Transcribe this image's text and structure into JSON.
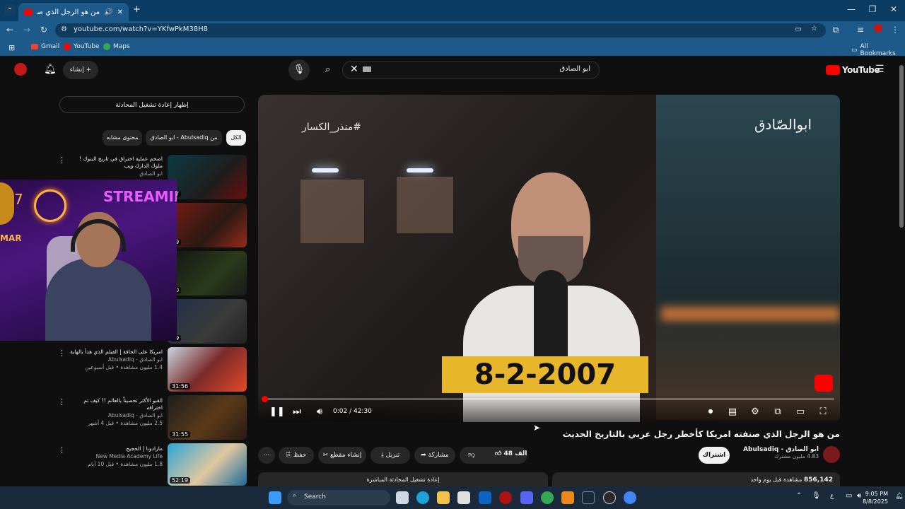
{
  "browser": {
    "tab_title": "من هو الرجل الذي صنفته امر",
    "url": "youtube.com/watch?v=YKfwPkM38H8",
    "bookmarks": [
      "Gmail",
      "YouTube",
      "Maps"
    ],
    "all_bookmarks": "All Bookmarks"
  },
  "youtube": {
    "logo": "YouTube",
    "search_query": "ابو الصادق",
    "create_label": "إنشاء",
    "show_chat_replay": "إظهار إعادة تشغيل المحادثة",
    "chips": [
      "الكل",
      "من Abulsadiq - ابو الصادق",
      "محتوى مشابه"
    ]
  },
  "video": {
    "hashtag": "#منذر_الكسار",
    "watermark": "ابوالصّادق",
    "date_banner": "8-2-2007",
    "time": "0:02 / 42:30",
    "progress": 0.001,
    "title": "من هو الرجل الذي صنفته امريكا كأخطر رجل عربي بالتاريخ الحديث",
    "channel": "Abulsadiq - ابو الصادق",
    "subscribers": "4.83 مليون مشترك",
    "subscribe": "اشتراك",
    "likes": "48 الف",
    "share": "مشاركة",
    "download": "تنزيل",
    "clip": "إنشاء مقطع",
    "save": "حفظ",
    "views": "856,142",
    "views_meta": "مشاهدة قبل يوم واحد",
    "chat_replay_bottom": "إعادة تشغيل المحادثة المباشرة"
  },
  "related": [
    {
      "title": "اضخم عملية اختراق في تاريخ البنوك ! ملوك الدارك ويب",
      "channel": "ابو الصادق",
      "meta": "",
      "duration": "27"
    },
    {
      "title": "",
      "channel": "",
      "meta": "",
      "duration": "49"
    },
    {
      "title": "",
      "channel": "",
      "meta": "",
      "duration": "30"
    },
    {
      "title": "",
      "channel": "",
      "meta": "",
      "duration": "29"
    },
    {
      "title": "امريكا على الحافة | الفيلم الذي هدأ بالهاية",
      "channel": "ابو الصادق - Abulsadiq",
      "meta": "1.4 مليون مشاهدة • قبل أسبوعين",
      "duration": "31:56"
    },
    {
      "title": "القبو الأكثر تحصيناً بالعالم !! كيف تم اختراقه",
      "channel": "ابو الصادق - Abulsadiq",
      "meta": "2.5 مليون مشاهدة • قبل 4 أشهر",
      "duration": "31:55"
    },
    {
      "title": "مارادونا | الحجيح",
      "channel": "New Media Academy Life",
      "meta": "1.8 مليون مشاهدة • قبل 10 أيام",
      "duration": "52:19"
    }
  ],
  "stream_overlay": {
    "label": "STREAMIN",
    "num": "7",
    "name": "MAR"
  },
  "taskbar": {
    "search": "Search",
    "time": "9:05 PM",
    "date": "8/8/2025",
    "lang": "ع"
  }
}
